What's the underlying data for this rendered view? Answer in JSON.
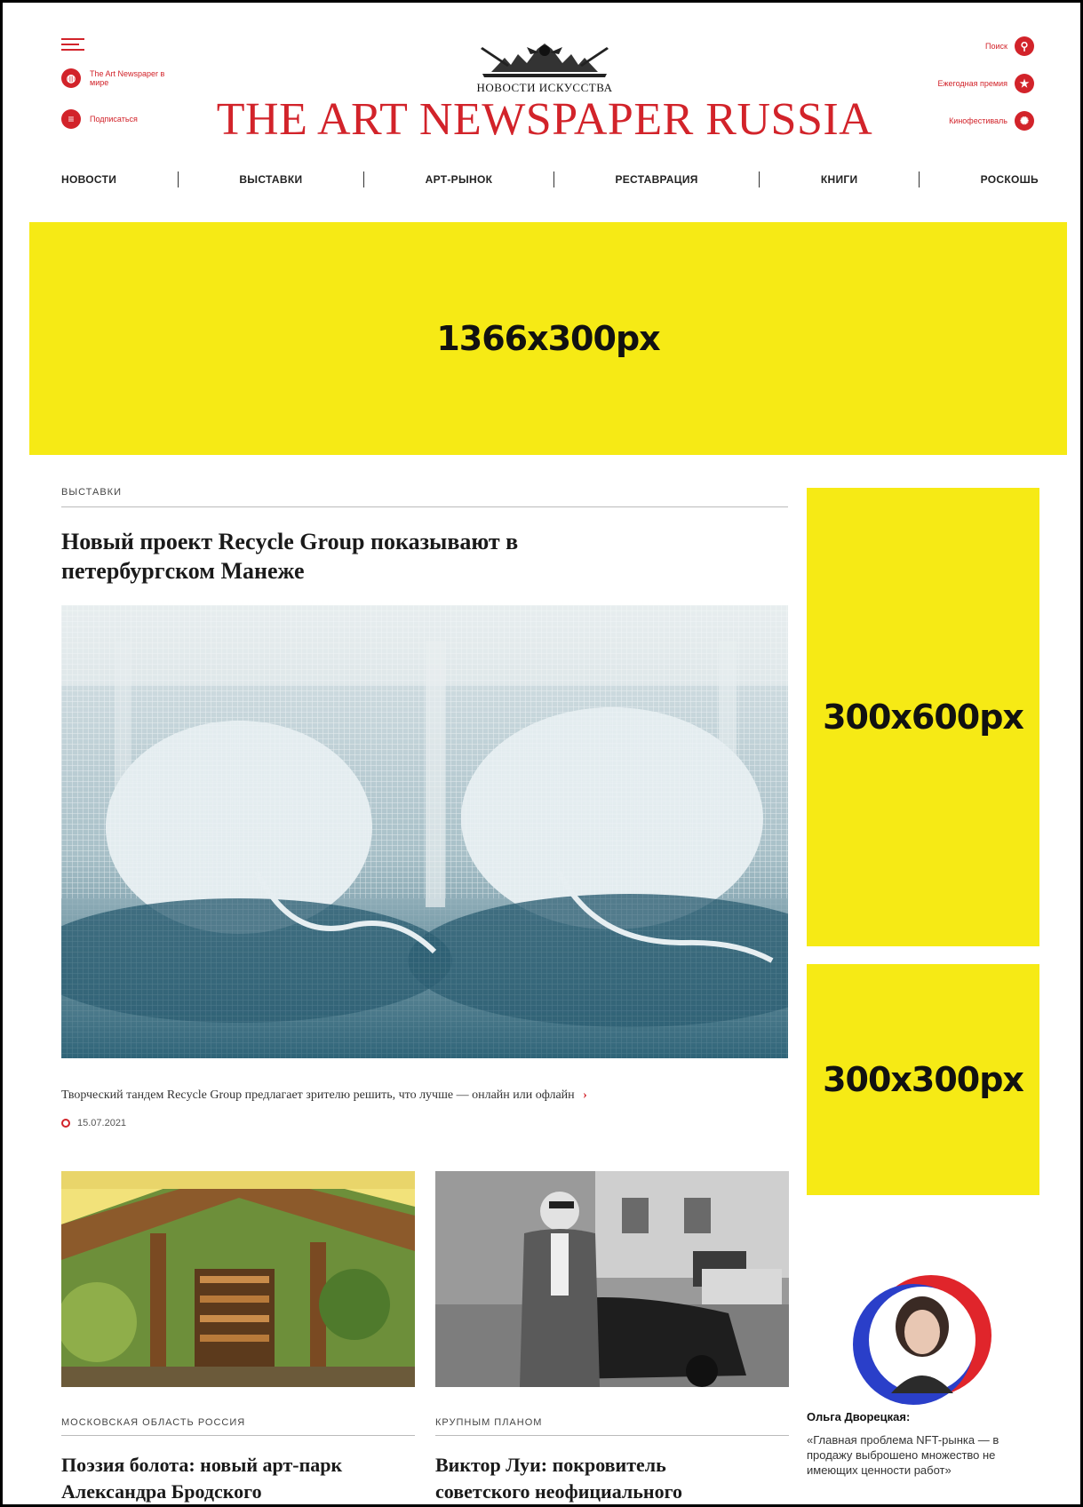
{
  "header": {
    "left_links": [
      {
        "label": "The Art Newspaper в мире",
        "icon": "globe-icon"
      },
      {
        "label": "Подписаться",
        "icon": "subscribe-icon"
      }
    ],
    "right_links": [
      {
        "label": "Поиск",
        "icon": "search-icon"
      },
      {
        "label": "Ежегодная премия",
        "icon": "star-icon"
      },
      {
        "label": "Кинофестиваль",
        "icon": "film-icon"
      }
    ],
    "logo_sub": "НОВОСТИ ИСКУССТВА",
    "logo_title": "THE ART NEWSPAPER RUSSIA"
  },
  "nav": [
    "НОВОСТИ",
    "ВЫСТАВКИ",
    "АРТ-РЫНОК",
    "РЕСТАВРАЦИЯ",
    "КНИГИ",
    "РОСКОШЬ"
  ],
  "ads": {
    "top": "1366x300px",
    "side_tall": "300x600px",
    "side_square": "300x300px"
  },
  "main_article": {
    "section": "ВЫСТАВКИ",
    "title_line1": "Новый проект Recycle Group показывают в",
    "title_line2": "петербургском Манеже",
    "lead": "Творческий тандем Recycle Group предлагает зрителю решить, что лучше — онлайн или офлайн",
    "date": "15.07.2021"
  },
  "cards": [
    {
      "section": "МОСКОВСКАЯ ОБЛАСТЬ РОССИЯ",
      "title_line1": "Поэзия болота: новый арт-парк",
      "title_line2": "Александра Бродского"
    },
    {
      "section": "КРУПНЫМ ПЛАНОМ",
      "title_line1": "Виктор Луи: покровитель",
      "title_line2": "советского неофициального"
    }
  ],
  "quote": {
    "name": "Ольга Дворецкая:",
    "text": "«Главная проблема NFT-рынка — в продажу выброшено множество не имеющих ценности работ»"
  },
  "colors": {
    "brand_red": "#d2232a",
    "ad_yellow": "#f6ea15"
  }
}
